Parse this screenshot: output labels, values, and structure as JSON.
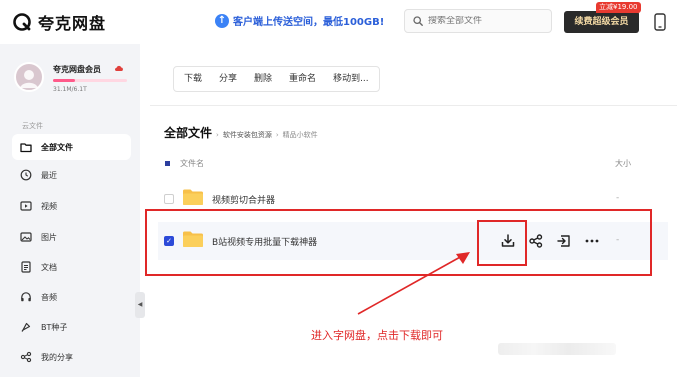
{
  "app": {
    "name": "夸克网盘",
    "promo": "客户端上传送空间，最低100GB!",
    "search_placeholder": "搜索全部文件",
    "vip_button": "续费超级会员",
    "vip_price": "立减¥19.00"
  },
  "user": {
    "name": "夸克网盘会员",
    "quota": "31.1M/6.1T",
    "quota_fraction": 0.3
  },
  "sidebar": {
    "section": "云文件",
    "items": [
      {
        "label": "全部文件",
        "icon": "folder-icon",
        "active": true
      },
      {
        "label": "最近",
        "icon": "clock-icon",
        "active": false
      },
      {
        "label": "视频",
        "icon": "video-icon",
        "active": false
      },
      {
        "label": "图片",
        "icon": "image-icon",
        "active": false
      },
      {
        "label": "文档",
        "icon": "document-icon",
        "active": false
      },
      {
        "label": "音频",
        "icon": "headphones-icon",
        "active": false
      },
      {
        "label": "BT种子",
        "icon": "torrent-icon",
        "active": false
      },
      {
        "label": "我的分享",
        "icon": "share-icon",
        "active": false
      }
    ]
  },
  "toolbar": {
    "download": "下载",
    "share": "分享",
    "delete": "删除",
    "rename": "重命名",
    "move": "移动到..."
  },
  "breadcrumb": {
    "root": "全部文件",
    "sep": "›",
    "items": [
      "软件安装包资源",
      "精品小软件"
    ]
  },
  "table": {
    "col_name": "文件名",
    "col_size": "大小",
    "rows": [
      {
        "name": "视频剪切合并器",
        "size": "-",
        "checked": false
      },
      {
        "name": "B站视频专用批量下载神器",
        "size": "-",
        "checked": true
      }
    ]
  },
  "annotation": {
    "text": "进入字网盘，点击下载即可",
    "color": "#e02828"
  },
  "colors": {
    "accent": "#2c4ad8",
    "folder": "#f7c04a",
    "highlight": "#e02828"
  }
}
